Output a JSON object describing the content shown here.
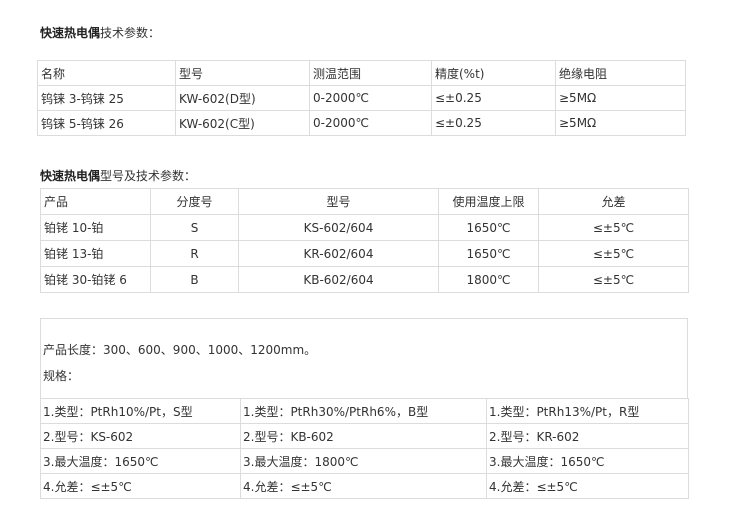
{
  "section1": {
    "title_bold": "快速热电偶",
    "title_rest": "技术参数：",
    "headers": [
      "名称",
      "型号",
      "测温范围",
      "精度(%t)",
      "绝缘电阻"
    ],
    "rows": [
      [
        "钨铼 3-钨铼 25",
        "KW-602(D型)",
        "0-2000℃",
        "≤±0.25",
        "≥5MΩ"
      ],
      [
        "钨铼 5-钨铼 26",
        "KW-602(C型)",
        "0-2000℃",
        "≤±0.25",
        "≥5MΩ"
      ]
    ]
  },
  "section2": {
    "title_bold": "快速热电偶",
    "title_rest": "型号及技术参数：",
    "headers": [
      "产品",
      "分度号",
      "型号",
      "使用温度上限",
      "允差"
    ],
    "rows": [
      [
        "铂铑 10-铂",
        "S",
        "KS-602/604",
        "1650℃",
        "≤±5℃"
      ],
      [
        "铂铑 13-铂",
        "R",
        "KR-602/604",
        "1650℃",
        "≤±5℃"
      ],
      [
        "铂铑 30-铂铑 6",
        "B",
        "KB-602/604",
        "1800℃",
        "≤±5℃"
      ]
    ]
  },
  "section3": {
    "length_text": "产品长度：300、600、900、1000、1200mm。",
    "spec_label": "规格：",
    "columns": [
      [
        "1.类型：PtRh10%/Pt，S型",
        "2.型号：KS-602",
        "3.最大温度：1650℃",
        "4.允差：≤±5℃"
      ],
      [
        "1.类型：PtRh30%/PtRh6%，B型",
        "2.型号：KB-602",
        "3.最大温度：1800℃",
        "4.允差：≤±5℃"
      ],
      [
        "1.类型：PtRh13%/Pt，R型",
        "2.型号：KR-602",
        "3.最大温度：1650℃",
        "4.允差：≤±5℃"
      ]
    ]
  }
}
